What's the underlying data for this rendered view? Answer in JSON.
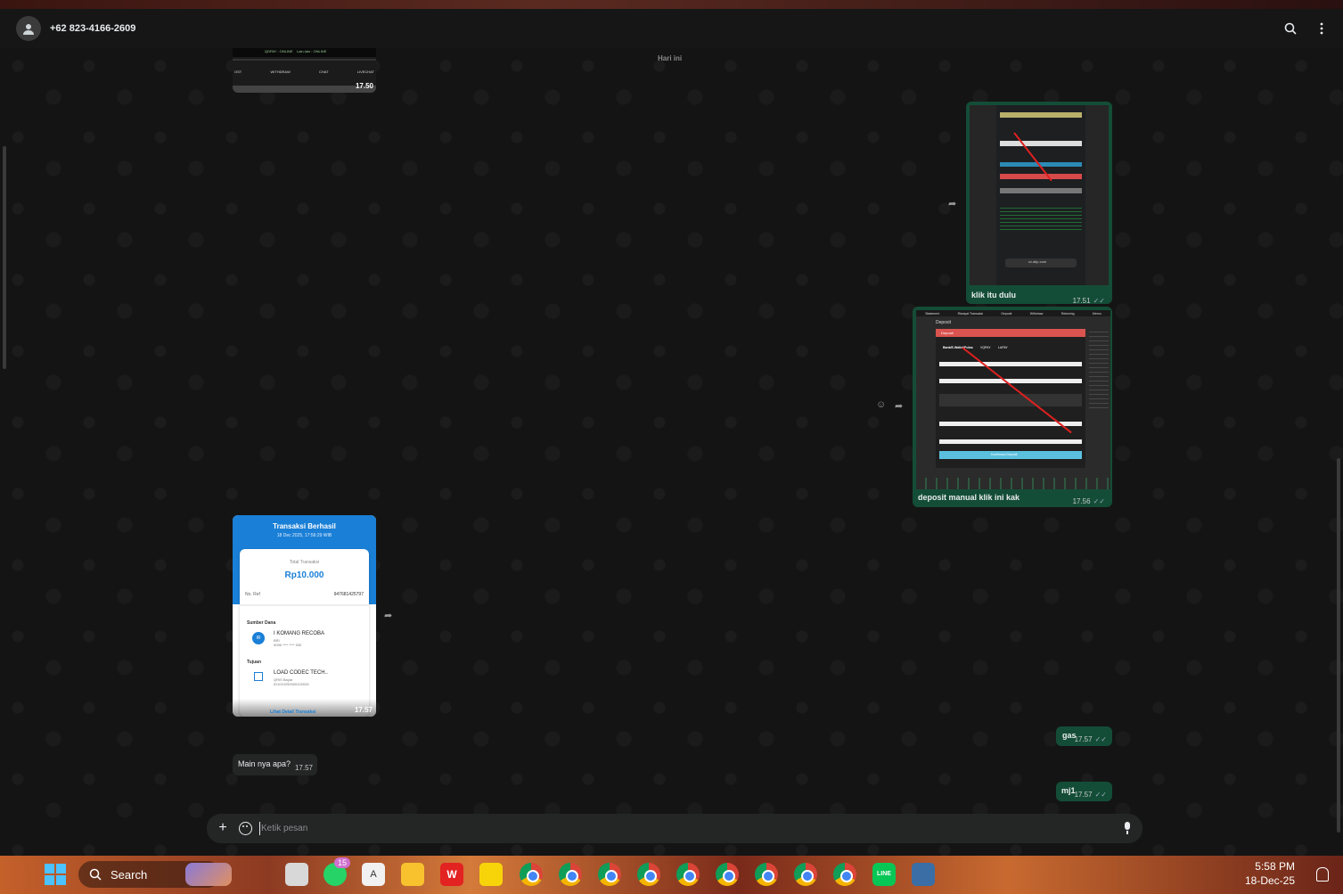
{
  "header": {
    "contact_name": "+62 823-4166-2609"
  },
  "chat": {
    "day_separator": "Hari ini",
    "top_image_time": "17.50",
    "top_image_labels": [
      "OST",
      "WITHDRAW",
      "CHAT",
      "LIVECHAT"
    ],
    "top_image_status": "QDPAY : ONLINE    Lain-lain : ONLINE",
    "msg1": {
      "caption": "klik itu dulu",
      "time": "17.51",
      "image_footer": "cv.ddp.com"
    },
    "msg2": {
      "caption": "deposit manual klik ini kak",
      "time": "17.56",
      "image_tabs": [
        "Statement",
        "Riwayat Transaksi",
        "Deposit",
        "Withdraw",
        "Rekening",
        "Memo"
      ],
      "image_title": "Deposit",
      "image_panel": "Deposit",
      "image_methods": [
        "Bank/E-Wallet/Pulsa",
        "VQPAY",
        "LAPAY"
      ],
      "image_fields": [
        "Rekening Asal",
        "Rekening Tujuan Deposit",
        "Jumlah",
        "Catatan Nomor Refund (Referensi)"
      ],
      "image_button": "Konfirmasi Deposit"
    },
    "msg3": {
      "time": "17.57",
      "receipt_title": "Transaksi Berhasil",
      "receipt_date": "18 Dec 2025, 17:56:29 WIB",
      "total_label": "Total Transaksi",
      "amount": "Rp10.000",
      "ref_label": "No. Ref",
      "ref_value": "947681425797",
      "source_label": "Sumber Dana",
      "source_initials": "IR",
      "source_name": "I KOMANG RECOBA",
      "source_bank": "BRI",
      "source_account": "0096 **** **** 530",
      "dest_label": "Tujuan",
      "dest_name": "LOAD CODEC TECH..",
      "dest_sub": "QRIS Bayar",
      "dest_id": "ID1010250000102026",
      "detail_link": "Lihat Detail Transaksi"
    },
    "msg4": {
      "text": "gas",
      "time": "17.57"
    },
    "msg5": {
      "text": "Main nya apa?",
      "time": "17.57"
    },
    "msg6": {
      "text": "mj1",
      "time": "17.57"
    }
  },
  "composer": {
    "placeholder": "Ketik pesan"
  },
  "taskbar": {
    "search_label": "Search",
    "whatsapp_badge": "15",
    "time": "5:58 PM",
    "date": "18-Dec-25"
  },
  "colors": {
    "outgoing_bubble": "#144d37",
    "incoming_bubble": "#242626",
    "header": "#161616",
    "accent_green": "#25d366"
  }
}
